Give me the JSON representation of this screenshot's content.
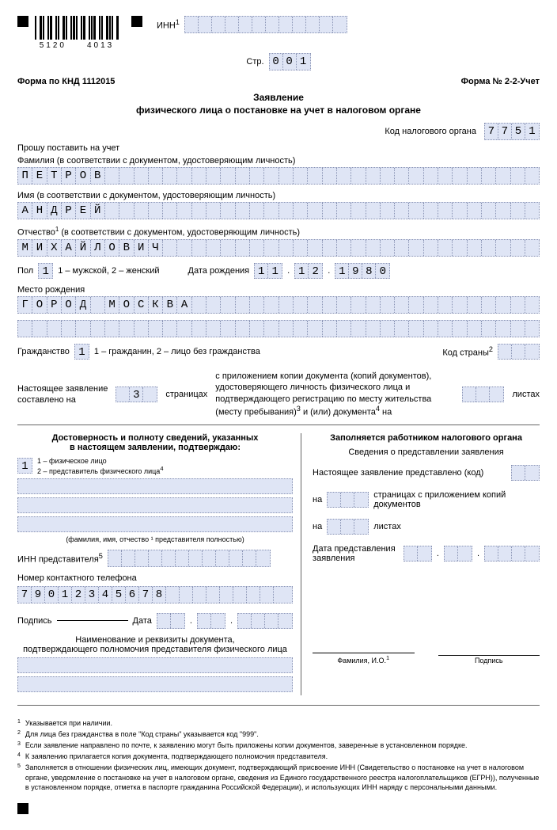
{
  "header": {
    "inn_label": "ИНН",
    "inn_sup": "1",
    "barcode_left": "5120",
    "barcode_right": "4013",
    "page_label": "Стр.",
    "page_value": "001",
    "form_knd": "Форма по КНД 1112015",
    "form_num": "Форма № 2-2-Учет"
  },
  "title": {
    "line1": "Заявление",
    "line2": "физического лица о постановке на учет в налоговом органе"
  },
  "tax_org": {
    "label": "Код налогового органа",
    "value": "7751"
  },
  "request_label": "Прошу поставить на учет",
  "surname": {
    "label": "Фамилия (в соответствии с документом, удостоверяющим личность)",
    "value": "ПЕТРОВ"
  },
  "name": {
    "label": "Имя (в соответствии с документом, удостоверяющим личность)",
    "value": "АНДРЕЙ"
  },
  "patronymic": {
    "label_prefix": "Отчество",
    "label_sup": "1",
    "label_suffix": " (в соответствии с документом, удостоверяющим личность)",
    "value": "МИХАЙЛОВИЧ"
  },
  "sex": {
    "label": "Пол",
    "value": "1",
    "hint": "1 – мужской, 2 – женский"
  },
  "dob": {
    "label": "Дата рождения",
    "day": "11",
    "month": "12",
    "year": "1980"
  },
  "birthplace": {
    "label": "Место рождения",
    "value": "ГОРОД МОСКВА"
  },
  "citizenship": {
    "label": "Гражданство",
    "value": "1",
    "hint": "1 – гражданин, 2 – лицо без гражданства",
    "country_label": "Код страны",
    "country_sup": "2"
  },
  "attach": {
    "prefix": "Настоящее заявление\nсоставлено на",
    "pages": "3",
    "pages_label": "страницах",
    "middle": "с приложением копии документа (копий документов), удостоверяющего личность физического лица и подтверждающего регистрацию по месту жительства (месту пребывания)",
    "sup3": "3",
    "middle2": " и (или) документа",
    "sup4": "4",
    "middle3": " на",
    "sheets_label": "листах"
  },
  "left_col": {
    "title": "Достоверность и полноту сведений, указанных\nв настоящем заявлении, подтверждаю:",
    "role": "1",
    "role_hint1": "1 – физическое лицо",
    "role_hint2": "2 – представитель физического лица",
    "role_sup": "4",
    "fio_caption": "(фамилия, имя, отчество ¹ представителя полностью)",
    "inn_rep_label": "ИНН представителя",
    "inn_rep_sup": "5",
    "phone_label": "Номер контактного телефона",
    "phone": "79012345678",
    "sign_label": "Подпись",
    "date_label": "Дата",
    "doc_title": "Наименование и реквизиты документа,\nподтверждающего полномочия представителя физического лица"
  },
  "right_col": {
    "title": "Заполняется работником налогового органа",
    "subtitle": "Сведения о представлении заявления",
    "r1": "Настоящее заявление представлено (код)",
    "r2_prefix": "на",
    "r2_suffix": "страницах с приложением копий документов",
    "r3_prefix": "на",
    "r3_suffix": "листах",
    "r4": "Дата представления\nзаявления",
    "fio_cap": "Фамилия, И.О.",
    "fio_sup": "1",
    "sign_cap": "Подпись"
  },
  "footnotes": {
    "n1": "Указывается при наличии.",
    "n2": "Для лица без гражданства в поле \"Код страны\" указывается код \"999\".",
    "n3": "Если заявление направлено по почте, к заявлению могут быть приложены копии документов, заверенные в установленном порядке.",
    "n4": "К заявлению прилагается копия документа, подтверждающего полномочия представителя.",
    "n5": "Заполняется в отношении физических лиц, имеющих документ, подтверждающий присвоение ИНН (Свидетельство о постановке на учет в налоговом органе, уведомление о постановке на учет в налоговом органе, сведения из Единого государственного реестра налогоплательщиков (ЕГРН)), полученные в установленном порядке, отметка в паспорте гражданина Российской Федерации), и использующих ИНН наряду с персональными данными."
  }
}
